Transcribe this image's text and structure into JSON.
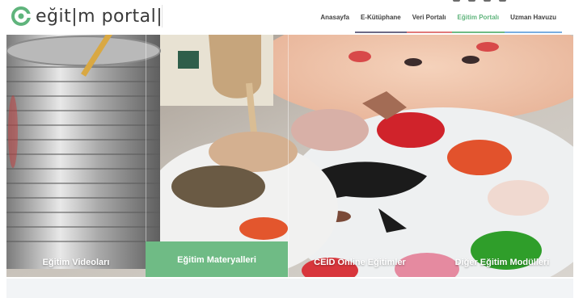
{
  "brand": {
    "logo_text": "eğit|m portal|",
    "accent": "#5fb47c"
  },
  "nav": {
    "items": [
      {
        "label": "Anasayfa",
        "underline": "#ffffff",
        "active": false
      },
      {
        "label": "E-Kütüphane",
        "underline": "#6d6a86",
        "active": false
      },
      {
        "label": "Veri Portalı",
        "underline": "#e07a7a",
        "active": false
      },
      {
        "label": "Eğitim Portalı",
        "underline": "#6fbb85",
        "active": true
      },
      {
        "label": "Uzman Havuzu",
        "underline": "#7aaee0",
        "active": false
      }
    ]
  },
  "hero": {
    "panels": [
      {
        "label": "Eğitim Videoları",
        "active": false
      },
      {
        "label": "Eğitim Materyalleri",
        "active": true
      },
      {
        "label": "CEİD Online Eğitimler",
        "active": false
      },
      {
        "label": "Diğer Eğitim Modülleri",
        "active": false
      }
    ]
  }
}
